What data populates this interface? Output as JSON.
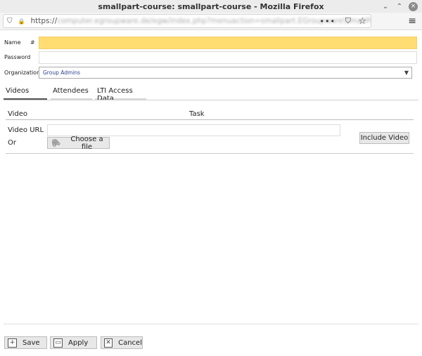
{
  "window": {
    "title": "smallpart-course: smallpart-course - Mozilla Firefox",
    "min_icon": "⌄",
    "max_icon": "⌃",
    "close_icon": "×"
  },
  "browser": {
    "url_visible": "https://",
    "url_blurred": "computer.egroupware.de/egw/index.php?menuaction=smallpart.EGroupware\\SmallParT\\Cc",
    "shield_glyph": "⛉",
    "lock_glyph": "🔒",
    "more_glyph": "•••",
    "pocket_glyph": "⛉",
    "star_glyph": "☆",
    "menu_glyph": "≡"
  },
  "form": {
    "name_label": "Name",
    "name_hash": "#",
    "name_value": "",
    "password_label": "Password",
    "password_value": "",
    "organization_label": "Organization",
    "organization_value": "Group Admins",
    "organization_arrow": "▼"
  },
  "tabs": [
    {
      "label": "Videos",
      "active": true
    },
    {
      "label": "Attendees",
      "active": false
    },
    {
      "label": "LTI Access Data",
      "active": false
    }
  ],
  "videos": {
    "col_video": "Video",
    "col_task": "Task",
    "video_url_label": "Video URL",
    "video_url_value": "",
    "or_label": "Or",
    "choose_file_label": "Choose a file",
    "clip_glyph": "🖇",
    "include_video_label": "Include Video"
  },
  "footer": {
    "save_label": "Save",
    "apply_label": "Apply",
    "cancel_label": "Cancel",
    "save_glyph": "+",
    "apply_glyph": "▭",
    "cancel_glyph": "✕"
  }
}
